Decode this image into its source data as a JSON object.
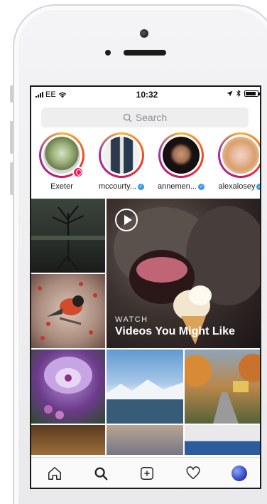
{
  "status_bar": {
    "carrier": "EE",
    "time": "10:32"
  },
  "search": {
    "placeholder": "Search"
  },
  "stories": [
    {
      "label": "Exeter",
      "type": "location"
    },
    {
      "label": "mccourty...",
      "verified": true
    },
    {
      "label": "annemen...",
      "verified": true
    },
    {
      "label": "alexalosey",
      "verified": true
    }
  ],
  "explore": {
    "featured_video": {
      "overline": "WATCH",
      "title": "Videos You Might Like"
    }
  },
  "tab_bar": {
    "tabs": [
      "home-icon",
      "search-icon",
      "add-post-icon",
      "heart-icon",
      "profile-avatar"
    ]
  },
  "colors": {
    "story_ring": "#d4145a",
    "verified_badge": "#3897f0",
    "location_pin": "#ed1c5b"
  }
}
